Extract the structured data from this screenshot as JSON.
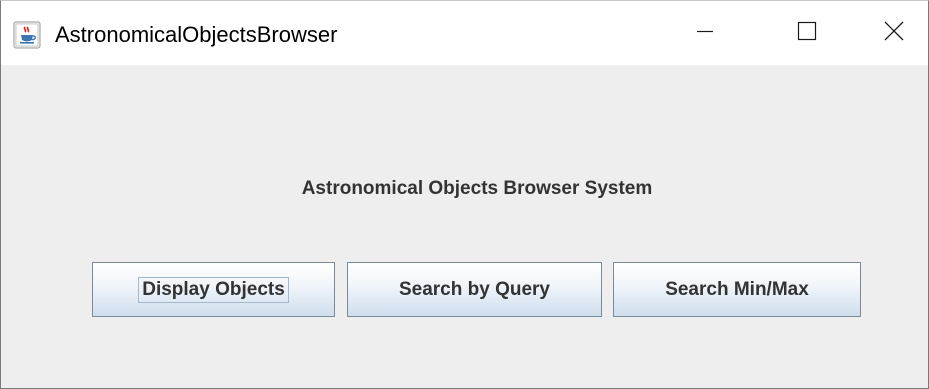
{
  "window": {
    "title": "AstronomicalObjectsBrowser",
    "app_icon": "java-coffee-cup-icon",
    "controls": {
      "minimize_icon": "minimize-icon",
      "maximize_icon": "maximize-icon",
      "close_icon": "close-icon"
    }
  },
  "main": {
    "heading": "Astronomical Objects Browser System",
    "buttons": [
      {
        "label": "Display Objects",
        "focused": true
      },
      {
        "label": "Search by Query",
        "focused": false
      },
      {
        "label": "Search Min/Max",
        "focused": false
      }
    ]
  },
  "colors": {
    "client_background": "#eeeeee",
    "title_bar_background": "#ffffff",
    "button_border": "#7a8a99",
    "button_gradient_bottom": "#cfdeec",
    "text": "#333333"
  }
}
